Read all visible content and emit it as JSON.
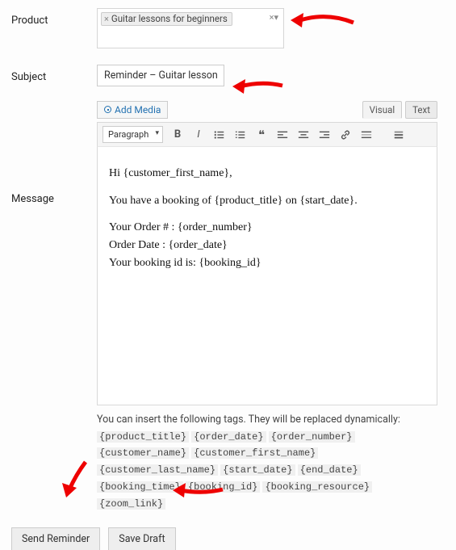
{
  "product": {
    "label": "Product",
    "tag": "Guitar lessons for beginners"
  },
  "subject": {
    "label": "Subject",
    "value": "Reminder – Guitar lessons fo"
  },
  "media": {
    "add_media": "Add Media",
    "tabs": {
      "visual": "Visual",
      "text": "Text"
    }
  },
  "toolbar": {
    "paragraph": "Paragraph"
  },
  "editor": {
    "p1": "Hi {customer_first_name},",
    "p2": "You have a booking of {product_title} on {start_date}.",
    "p3a": "Your Order # : {order_number}",
    "p3b": "Order Date : {order_date}",
    "p3c": "Your booking id is: {booking_id}"
  },
  "message_label": "Message",
  "tags_help": {
    "intro": "You can insert the following tags. They will be replaced dynamically: ",
    "t1": "{product_title}",
    "t2": "{order_date}",
    "t3": "{order_number}",
    "t4": "{customer_name}",
    "t5": "{customer_first_name}",
    "t6": "{customer_last_name}",
    "t7": "{start_date}",
    "t8": "{end_date}",
    "t9": "{booking_time}",
    "t10": "{booking_id}",
    "t11": "{booking_resource}",
    "t12": "{zoom_link}"
  },
  "buttons": {
    "send": "Send Reminder",
    "save": "Save Draft"
  }
}
